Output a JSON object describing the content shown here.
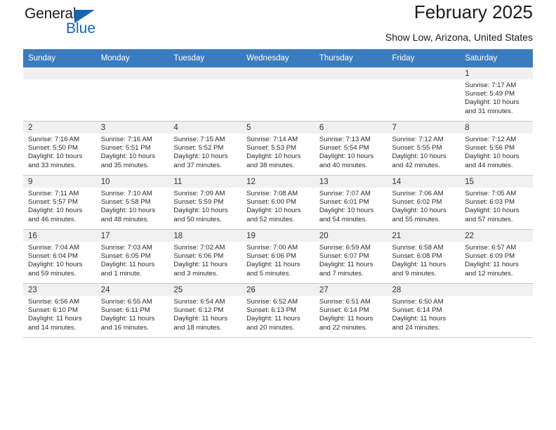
{
  "brand": {
    "name_part1": "General",
    "name_part2": "Blue",
    "accent_color": "#1567b5",
    "triangle_icon": "triangle-icon"
  },
  "header": {
    "title": "February 2025",
    "subtitle": "Show Low, Arizona, United States"
  },
  "calendar": {
    "header_bg": "#3a7cbe",
    "daynum_bg": "#f0f0f0",
    "weekday_headers": [
      "Sunday",
      "Monday",
      "Tuesday",
      "Wednesday",
      "Thursday",
      "Friday",
      "Saturday"
    ],
    "weeks": [
      [
        {
          "day": "",
          "sunrise": "",
          "sunset": "",
          "daylight_line1": "",
          "daylight_line2": ""
        },
        {
          "day": "",
          "sunrise": "",
          "sunset": "",
          "daylight_line1": "",
          "daylight_line2": ""
        },
        {
          "day": "",
          "sunrise": "",
          "sunset": "",
          "daylight_line1": "",
          "daylight_line2": ""
        },
        {
          "day": "",
          "sunrise": "",
          "sunset": "",
          "daylight_line1": "",
          "daylight_line2": ""
        },
        {
          "day": "",
          "sunrise": "",
          "sunset": "",
          "daylight_line1": "",
          "daylight_line2": ""
        },
        {
          "day": "",
          "sunrise": "",
          "sunset": "",
          "daylight_line1": "",
          "daylight_line2": ""
        },
        {
          "day": "1",
          "sunrise": "Sunrise: 7:17 AM",
          "sunset": "Sunset: 5:49 PM",
          "daylight_line1": "Daylight: 10 hours",
          "daylight_line2": "and 31 minutes."
        }
      ],
      [
        {
          "day": "2",
          "sunrise": "Sunrise: 7:16 AM",
          "sunset": "Sunset: 5:50 PM",
          "daylight_line1": "Daylight: 10 hours",
          "daylight_line2": "and 33 minutes."
        },
        {
          "day": "3",
          "sunrise": "Sunrise: 7:16 AM",
          "sunset": "Sunset: 5:51 PM",
          "daylight_line1": "Daylight: 10 hours",
          "daylight_line2": "and 35 minutes."
        },
        {
          "day": "4",
          "sunrise": "Sunrise: 7:15 AM",
          "sunset": "Sunset: 5:52 PM",
          "daylight_line1": "Daylight: 10 hours",
          "daylight_line2": "and 37 minutes."
        },
        {
          "day": "5",
          "sunrise": "Sunrise: 7:14 AM",
          "sunset": "Sunset: 5:53 PM",
          "daylight_line1": "Daylight: 10 hours",
          "daylight_line2": "and 38 minutes."
        },
        {
          "day": "6",
          "sunrise": "Sunrise: 7:13 AM",
          "sunset": "Sunset: 5:54 PM",
          "daylight_line1": "Daylight: 10 hours",
          "daylight_line2": "and 40 minutes."
        },
        {
          "day": "7",
          "sunrise": "Sunrise: 7:12 AM",
          "sunset": "Sunset: 5:55 PM",
          "daylight_line1": "Daylight: 10 hours",
          "daylight_line2": "and 42 minutes."
        },
        {
          "day": "8",
          "sunrise": "Sunrise: 7:12 AM",
          "sunset": "Sunset: 5:56 PM",
          "daylight_line1": "Daylight: 10 hours",
          "daylight_line2": "and 44 minutes."
        }
      ],
      [
        {
          "day": "9",
          "sunrise": "Sunrise: 7:11 AM",
          "sunset": "Sunset: 5:57 PM",
          "daylight_line1": "Daylight: 10 hours",
          "daylight_line2": "and 46 minutes."
        },
        {
          "day": "10",
          "sunrise": "Sunrise: 7:10 AM",
          "sunset": "Sunset: 5:58 PM",
          "daylight_line1": "Daylight: 10 hours",
          "daylight_line2": "and 48 minutes."
        },
        {
          "day": "11",
          "sunrise": "Sunrise: 7:09 AM",
          "sunset": "Sunset: 5:59 PM",
          "daylight_line1": "Daylight: 10 hours",
          "daylight_line2": "and 50 minutes."
        },
        {
          "day": "12",
          "sunrise": "Sunrise: 7:08 AM",
          "sunset": "Sunset: 6:00 PM",
          "daylight_line1": "Daylight: 10 hours",
          "daylight_line2": "and 52 minutes."
        },
        {
          "day": "13",
          "sunrise": "Sunrise: 7:07 AM",
          "sunset": "Sunset: 6:01 PM",
          "daylight_line1": "Daylight: 10 hours",
          "daylight_line2": "and 54 minutes."
        },
        {
          "day": "14",
          "sunrise": "Sunrise: 7:06 AM",
          "sunset": "Sunset: 6:02 PM",
          "daylight_line1": "Daylight: 10 hours",
          "daylight_line2": "and 55 minutes."
        },
        {
          "day": "15",
          "sunrise": "Sunrise: 7:05 AM",
          "sunset": "Sunset: 6:03 PM",
          "daylight_line1": "Daylight: 10 hours",
          "daylight_line2": "and 57 minutes."
        }
      ],
      [
        {
          "day": "16",
          "sunrise": "Sunrise: 7:04 AM",
          "sunset": "Sunset: 6:04 PM",
          "daylight_line1": "Daylight: 10 hours",
          "daylight_line2": "and 59 minutes."
        },
        {
          "day": "17",
          "sunrise": "Sunrise: 7:03 AM",
          "sunset": "Sunset: 6:05 PM",
          "daylight_line1": "Daylight: 11 hours",
          "daylight_line2": "and 1 minute."
        },
        {
          "day": "18",
          "sunrise": "Sunrise: 7:02 AM",
          "sunset": "Sunset: 6:06 PM",
          "daylight_line1": "Daylight: 11 hours",
          "daylight_line2": "and 3 minutes."
        },
        {
          "day": "19",
          "sunrise": "Sunrise: 7:00 AM",
          "sunset": "Sunset: 6:06 PM",
          "daylight_line1": "Daylight: 11 hours",
          "daylight_line2": "and 5 minutes."
        },
        {
          "day": "20",
          "sunrise": "Sunrise: 6:59 AM",
          "sunset": "Sunset: 6:07 PM",
          "daylight_line1": "Daylight: 11 hours",
          "daylight_line2": "and 7 minutes."
        },
        {
          "day": "21",
          "sunrise": "Sunrise: 6:58 AM",
          "sunset": "Sunset: 6:08 PM",
          "daylight_line1": "Daylight: 11 hours",
          "daylight_line2": "and 9 minutes."
        },
        {
          "day": "22",
          "sunrise": "Sunrise: 6:57 AM",
          "sunset": "Sunset: 6:09 PM",
          "daylight_line1": "Daylight: 11 hours",
          "daylight_line2": "and 12 minutes."
        }
      ],
      [
        {
          "day": "23",
          "sunrise": "Sunrise: 6:56 AM",
          "sunset": "Sunset: 6:10 PM",
          "daylight_line1": "Daylight: 11 hours",
          "daylight_line2": "and 14 minutes."
        },
        {
          "day": "24",
          "sunrise": "Sunrise: 6:55 AM",
          "sunset": "Sunset: 6:11 PM",
          "daylight_line1": "Daylight: 11 hours",
          "daylight_line2": "and 16 minutes."
        },
        {
          "day": "25",
          "sunrise": "Sunrise: 6:54 AM",
          "sunset": "Sunset: 6:12 PM",
          "daylight_line1": "Daylight: 11 hours",
          "daylight_line2": "and 18 minutes."
        },
        {
          "day": "26",
          "sunrise": "Sunrise: 6:52 AM",
          "sunset": "Sunset: 6:13 PM",
          "daylight_line1": "Daylight: 11 hours",
          "daylight_line2": "and 20 minutes."
        },
        {
          "day": "27",
          "sunrise": "Sunrise: 6:51 AM",
          "sunset": "Sunset: 6:14 PM",
          "daylight_line1": "Daylight: 11 hours",
          "daylight_line2": "and 22 minutes."
        },
        {
          "day": "28",
          "sunrise": "Sunrise: 6:50 AM",
          "sunset": "Sunset: 6:14 PM",
          "daylight_line1": "Daylight: 11 hours",
          "daylight_line2": "and 24 minutes."
        },
        {
          "day": "",
          "sunrise": "",
          "sunset": "",
          "daylight_line1": "",
          "daylight_line2": ""
        }
      ]
    ]
  }
}
